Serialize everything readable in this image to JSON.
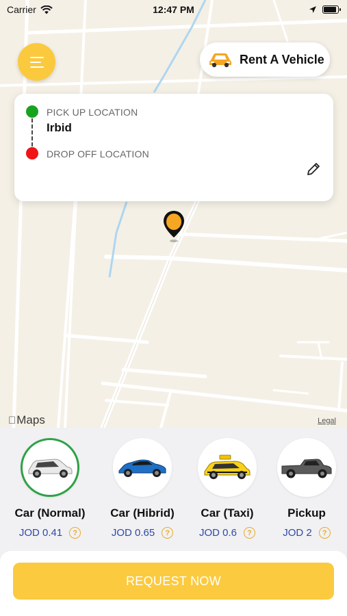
{
  "status_bar": {
    "carrier": "Carrier",
    "time": "12:47 PM"
  },
  "header": {
    "rent_vehicle_label": "Rent A Vehicle"
  },
  "location_card": {
    "pickup_label": "PICK UP LOCATION",
    "pickup_value": "Irbid",
    "dropoff_label": "DROP OFF LOCATION"
  },
  "map": {
    "attribution": "Maps",
    "legal": "Legal",
    "pin_color": "#f5a623"
  },
  "vehicles": [
    {
      "name": "Car (Normal)",
      "price": "JOD 0.41",
      "selected": true,
      "help": "?"
    },
    {
      "name": "Car (Hibrid)",
      "price": "JOD 0.65",
      "selected": false,
      "help": "?"
    },
    {
      "name": "Car (Taxi)",
      "price": "JOD 0.6",
      "selected": false,
      "help": "?"
    },
    {
      "name": "Pickup",
      "price": "JOD 2",
      "selected": false,
      "help": "?"
    }
  ],
  "request_button": {
    "label": "REQUEST NOW"
  },
  "colors": {
    "accent": "#fbc93d",
    "selected_border": "#2fa146",
    "price": "#2e4aa6",
    "pickup_dot": "#17a31d",
    "dropoff_dot": "#f01414"
  }
}
